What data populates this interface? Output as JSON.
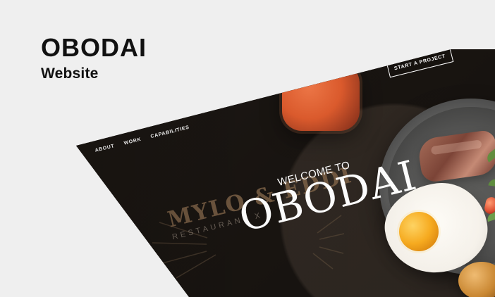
{
  "brand": {
    "title": "OBODAI",
    "subtitle": "Website"
  },
  "mockup": {
    "nav": [
      {
        "label": "ABOUT"
      },
      {
        "label": "WORK"
      },
      {
        "label": "CAPABILITIES"
      }
    ],
    "cta": {
      "label": "START A PROJECT"
    },
    "hero": {
      "kicker": "WELCOME TO",
      "title": "OBODAI"
    },
    "restaurant_logo": {
      "name": "MYLO & EDDI",
      "sub": "RESTAURANT X"
    }
  }
}
